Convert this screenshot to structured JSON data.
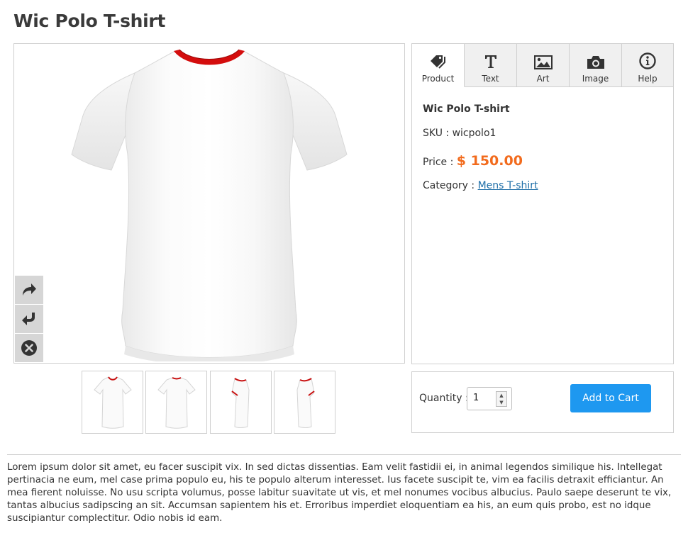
{
  "page": {
    "title": "Wic Polo T-shirt"
  },
  "tabs": [
    {
      "id": "product",
      "label": "Product",
      "icon": "tag-icon",
      "active": true
    },
    {
      "id": "text",
      "label": "Text",
      "icon": "text-icon",
      "active": false
    },
    {
      "id": "art",
      "label": "Art",
      "icon": "picture-icon",
      "active": false
    },
    {
      "id": "image",
      "label": "Image",
      "icon": "camera-icon",
      "active": false
    },
    {
      "id": "help",
      "label": "Help",
      "icon": "info-icon",
      "active": false
    }
  ],
  "product": {
    "name": "Wic Polo T-shirt",
    "sku_label": "SKU :",
    "sku": "wicpolo1",
    "price_label": "Price :",
    "price": "$ 150.00",
    "category_label": "Category :",
    "category": "Mens T-shirt"
  },
  "tools": [
    {
      "name": "redo-icon"
    },
    {
      "name": "undo-icon"
    },
    {
      "name": "delete-icon"
    }
  ],
  "thumbnails": [
    {
      "view": "front"
    },
    {
      "view": "back"
    },
    {
      "view": "left-side"
    },
    {
      "view": "right-side"
    }
  ],
  "cart": {
    "quantity_label": "Quantity :",
    "quantity": "1",
    "add_label": "Add to Cart"
  },
  "description": "Lorem ipsum dolor sit amet, eu facer suscipit vix. In sed dictas dissentias. Eam velit fastidii ei, in animal legendos similique his. Intellegat pertinacia ne eum, mel case prima populo eu, his te populo alterum interesset. Ius facete suscipit te, vim ea facilis detraxit efficiantur. An mea fierent noluisse. No usu scripta volumus, posse labitur suavitate ut vis, et mel nonumes vocibus albucius. Paulo saepe deserunt te vix, tantas albucius sadipscing an sit. Accumsan sapientem his et. Erroribus imperdiet eloquentiam ea his, an eum quis probo, est no idque suscipiantur complectitur. Odio nobis id eam.",
  "colors": {
    "accent": "#1e98f0",
    "price": "#f26b1d",
    "collar": "#d40d0d",
    "link": "#1f6fa8"
  }
}
